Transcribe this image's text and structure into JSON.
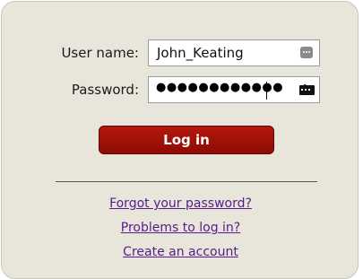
{
  "login": {
    "username_label": "User name:",
    "username_value": "John_Keating",
    "password_label": "Password:",
    "password_masked": "●●●●●●●●●●●●",
    "login_button": "Log in"
  },
  "links": {
    "forgot_password": "Forgot your password?",
    "problems": "Problems to log in?",
    "create_account": "Create an account"
  },
  "icons": {
    "username_field": "password-manager-icon",
    "password_field": "key-icon"
  },
  "colors": {
    "panel_background": "#e8e6da",
    "button_background": "#a11208",
    "link_color": "#5a1a8c"
  }
}
